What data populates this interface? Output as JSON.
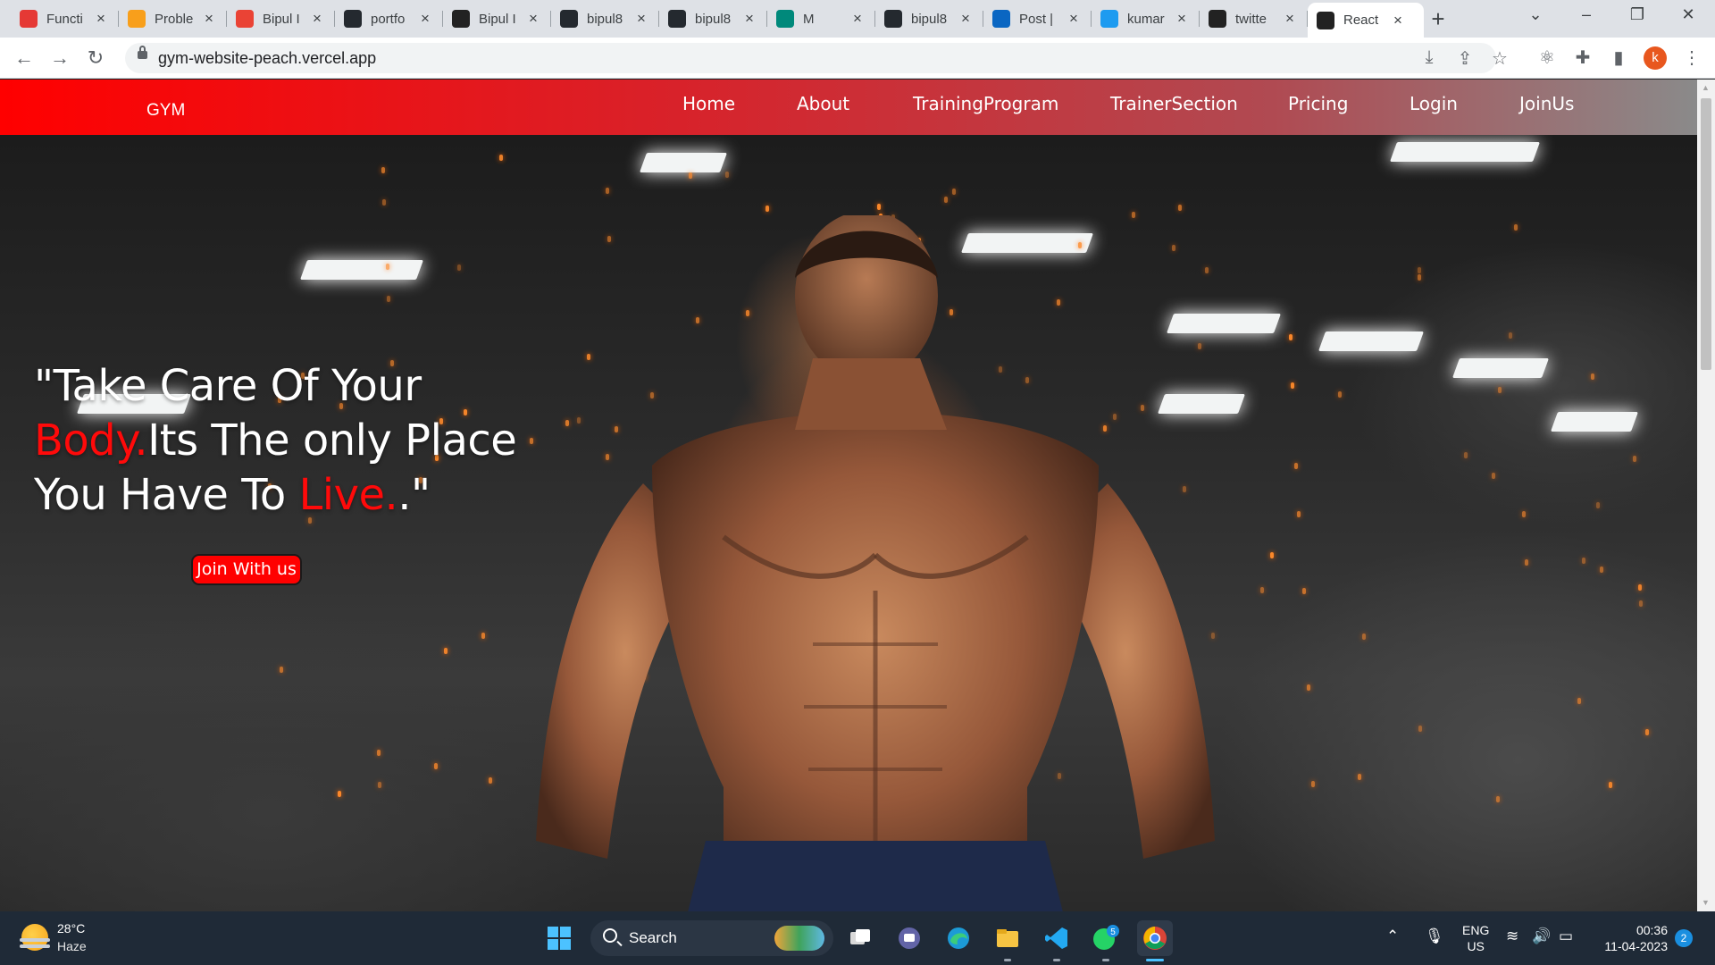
{
  "browser": {
    "tabs": [
      {
        "title": "Functi",
        "icon": "shield-icon",
        "color": "#e53935"
      },
      {
        "title": "Proble",
        "icon": "leetcode-icon",
        "color": "#f89f1b"
      },
      {
        "title": "Bipul I",
        "icon": "gmail-icon",
        "color": "#ea4335"
      },
      {
        "title": "portfo",
        "icon": "github-icon",
        "color": "#24292f"
      },
      {
        "title": "Bipul I",
        "icon": "react-icon",
        "color": "#222"
      },
      {
        "title": "bipul8",
        "icon": "github-icon",
        "color": "#24292f"
      },
      {
        "title": "bipul8",
        "icon": "github-icon",
        "color": "#24292f"
      },
      {
        "title": "M",
        "icon": "meet-icon",
        "color": "#00897b"
      },
      {
        "title": "bipul8",
        "icon": "github-icon",
        "color": "#24292f"
      },
      {
        "title": "Post |",
        "icon": "linkedin-icon",
        "color": "#0a66c2"
      },
      {
        "title": "kumar",
        "icon": "twitter-icon",
        "color": "#1d9bf0"
      },
      {
        "title": "twitte",
        "icon": "react-icon",
        "color": "#222"
      },
      {
        "title": "React",
        "icon": "react-icon",
        "color": "#222",
        "active": true
      }
    ],
    "url": "gym-website-peach.vercel.app",
    "profile_initial": "k"
  },
  "site": {
    "brand": "GYM",
    "nav": [
      "Home",
      "About",
      "TrainingProgram",
      "TrainerSection",
      "Pricing",
      "Login",
      "JoinUs"
    ],
    "headline": {
      "part1": "\"Take Care Of Your ",
      "red1": "Body.",
      "part2": "Its The only Place You Have To ",
      "red2": "Live.",
      "part3": ".\""
    },
    "cta": "Join With us",
    "accent_color": "#ff0000"
  },
  "taskbar": {
    "weather_temp": "28°C",
    "weather_condition": "Haze",
    "search_label": "Search",
    "language": "ENG",
    "region": "US",
    "time": "00:36",
    "date": "11-04-2023",
    "notification_count": "2",
    "whatsapp_badge": "5"
  }
}
